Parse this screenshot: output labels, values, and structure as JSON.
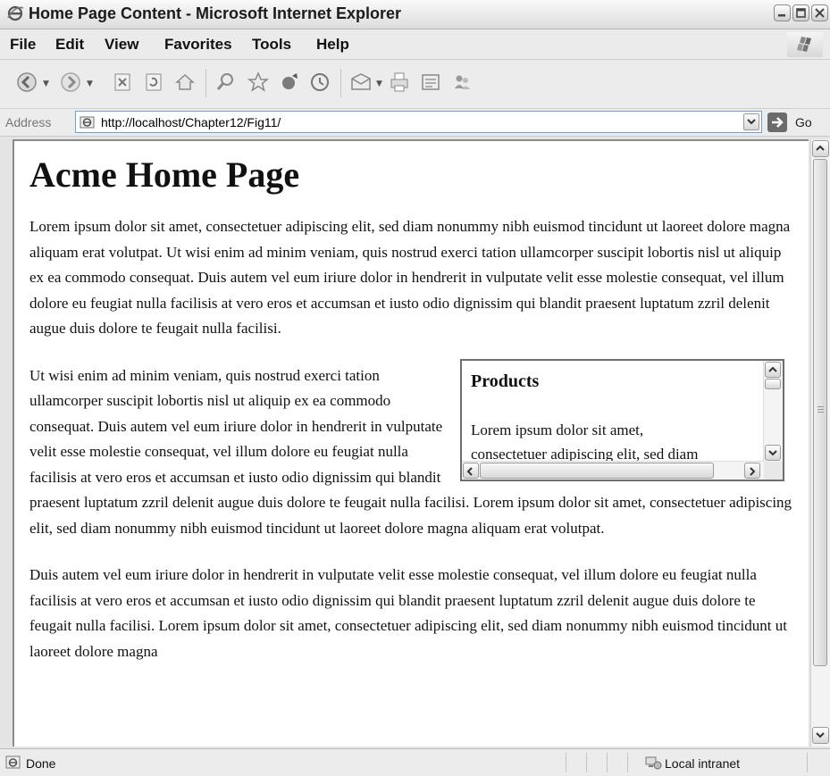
{
  "window": {
    "title": "Home Page Content - Microsoft Internet Explorer"
  },
  "menu": [
    "File",
    "Edit",
    "View",
    "Favorites",
    "Tools",
    "Help"
  ],
  "toolbar": {
    "icons": [
      "back-icon",
      "forward-icon",
      "stop-icon",
      "refresh-icon",
      "home-icon",
      "search-icon",
      "favorites-icon",
      "media-icon",
      "history-icon",
      "mail-icon",
      "print-icon",
      "edit-icon",
      "messenger-icon"
    ]
  },
  "address": {
    "label": "Address",
    "url": "http://localhost/Chapter12/Fig11/",
    "go_label": "Go"
  },
  "page": {
    "heading": "Acme Home Page",
    "paragraphs": [
      "Lorem ipsum dolor sit amet, consectetuer adipiscing elit, sed diam nonummy nibh euismod tincidunt ut laoreet dolore magna aliquam erat volutpat. Ut wisi enim ad minim veniam, quis nostrud exerci tation ullamcorper suscipit lobortis nisl ut aliquip ex ea commodo consequat. Duis autem vel eum iriure dolor in hendrerit in vulputate velit esse molestie consequat, vel illum dolore eu feugiat nulla facilisis at vero eros et accumsan et iusto odio dignissim qui blandit praesent luptatum zzril delenit augue duis dolore te feugait nulla facilisi.",
      "Ut wisi enim ad minim veniam, quis nostrud exerci tation ullamcorper suscipit lobortis nisl ut aliquip ex ea commodo consequat. Duis autem vel eum iriure dolor in hendrerit in vulputate velit esse molestie consequat, vel illum dolore eu feugiat nulla facilisis at vero eros et accumsan et iusto odio dignissim qui blandit praesent luptatum zzril delenit augue duis dolore te feugait nulla facilisi. Lorem ipsum dolor sit amet, consectetuer adipiscing elit, sed diam nonummy nibh euismod tincidunt ut laoreet dolore magna aliquam erat volutpat.",
      "Duis autem vel eum iriure dolor in hendrerit in vulputate velit esse molestie consequat, vel illum dolore eu feugiat nulla facilisis at vero eros et accumsan et iusto odio dignissim qui blandit praesent luptatum zzril delenit augue duis dolore te feugait nulla facilisi. Lorem ipsum dolor sit amet, consectetuer adipiscing elit, sed diam nonummy nibh euismod tincidunt ut laoreet dolore magna"
    ],
    "products": {
      "heading": "Products",
      "line1": "Lorem ipsum dolor sit amet,",
      "line2": "consectetuer adipiscing elit, sed diam"
    }
  },
  "status": {
    "text": "Done",
    "zone": "Local intranet"
  }
}
